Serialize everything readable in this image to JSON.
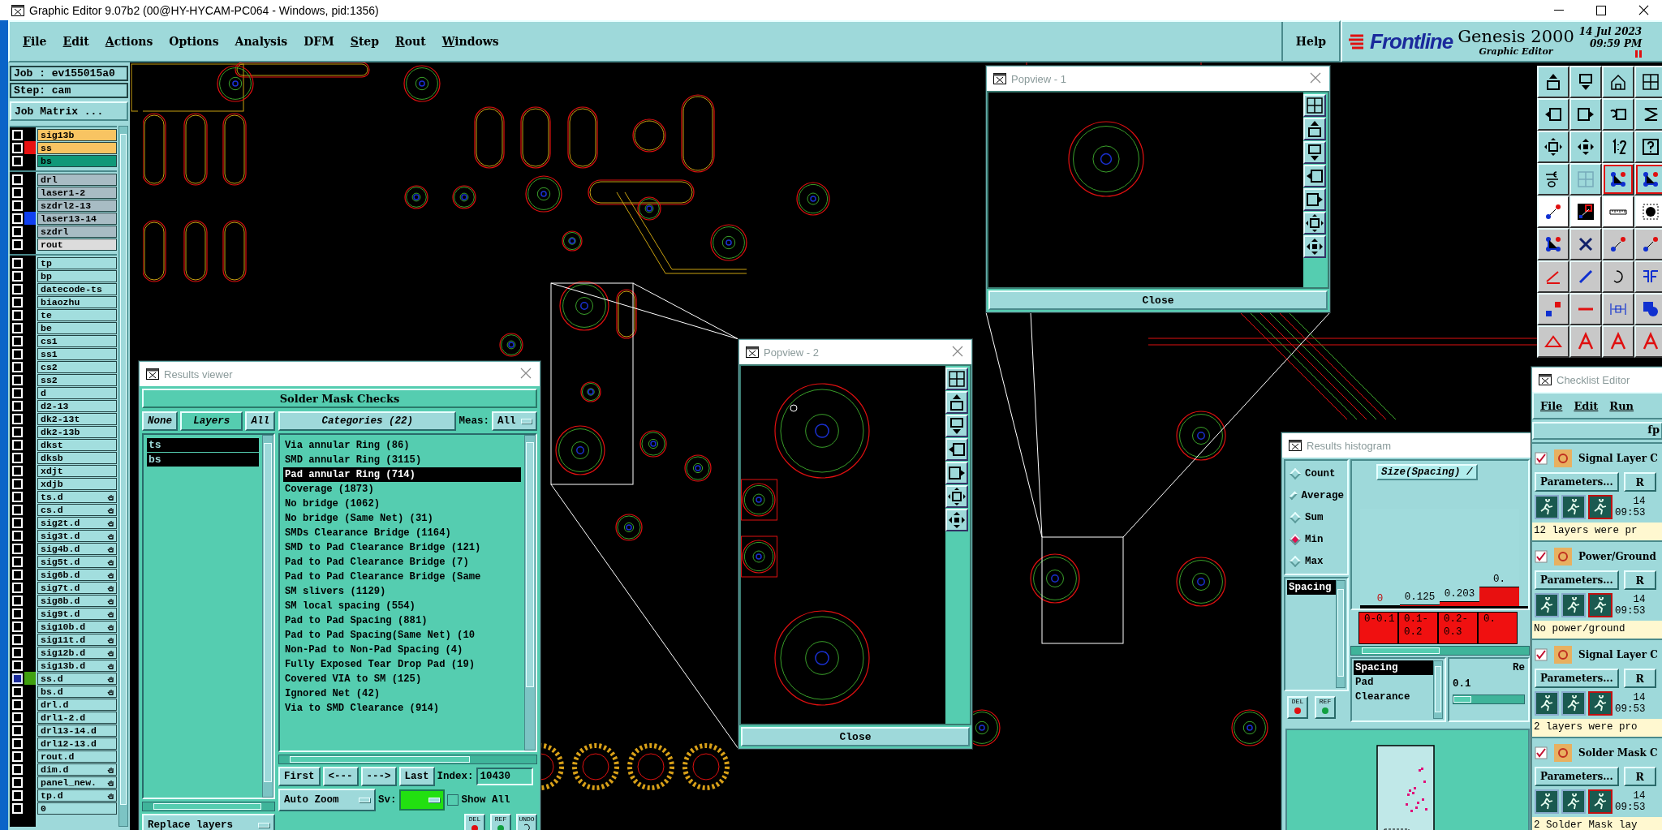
{
  "window": {
    "title": "Graphic Editor 9.07b2 (00@HY-HYCAM-PC064 - Windows, pid:1356)"
  },
  "menu": [
    {
      "label": "File",
      "underlined": true
    },
    {
      "label": "Edit",
      "underlined": true
    },
    {
      "label": "Actions",
      "underlined": true
    },
    {
      "label": "Options",
      "underlined": false
    },
    {
      "label": "Analysis",
      "underlined": false
    },
    {
      "label": "DFM",
      "underlined": false
    },
    {
      "label": "Step",
      "underlined": true
    },
    {
      "label": "Rout",
      "underlined": true
    },
    {
      "label": "Windows",
      "underlined": true
    }
  ],
  "help": "Help",
  "brand": {
    "logo": "Frontline",
    "product": "Genesis 2000",
    "subtitle": "Graphic Editor",
    "date": "14 Jul 2023",
    "time": "09:59 PM"
  },
  "job": {
    "job": "Job : ev155015a0",
    "step": "Step: cam",
    "matrix_button": "Job Matrix ..."
  },
  "layer_groups": [
    {
      "layers": [
        {
          "name": "sig13b",
          "kind": "signal",
          "selected": false,
          "hand": false
        },
        {
          "name": "ss",
          "kind": "signal",
          "color": "#e81010",
          "selected": false,
          "hand": false
        },
        {
          "name": "bs",
          "kind": "mask",
          "selected": false,
          "hand": false
        }
      ]
    },
    {
      "layers": [
        {
          "name": "drl",
          "kind": "drill",
          "selected": false,
          "hand": false
        },
        {
          "name": "laser1-2",
          "kind": "drill",
          "selected": false,
          "hand": false
        },
        {
          "name": "szdrl2-13",
          "kind": "drill",
          "selected": false,
          "hand": false
        },
        {
          "name": "laser13-14",
          "kind": "drill",
          "color": "#1040f0",
          "selected": false,
          "hand": false
        },
        {
          "name": "szdrl",
          "kind": "drill",
          "selected": false,
          "hand": false
        },
        {
          "name": "rout",
          "kind": "rout",
          "selected": false,
          "hand": false
        }
      ]
    },
    {
      "layers": [
        {
          "name": "tp",
          "kind": "misc",
          "selected": false,
          "hand": false
        },
        {
          "name": "bp",
          "kind": "misc",
          "selected": false,
          "hand": false
        },
        {
          "name": "datecode-ts",
          "kind": "misc",
          "selected": false,
          "hand": false
        },
        {
          "name": "biaozhu",
          "kind": "misc",
          "selected": false,
          "hand": false
        },
        {
          "name": "te",
          "kind": "misc",
          "selected": false,
          "hand": false
        },
        {
          "name": "be",
          "kind": "misc",
          "selected": false,
          "hand": false
        },
        {
          "name": "cs1",
          "kind": "misc",
          "selected": false,
          "hand": false
        },
        {
          "name": "ss1",
          "kind": "misc",
          "selected": false,
          "hand": false
        },
        {
          "name": "cs2",
          "kind": "misc",
          "selected": false,
          "hand": false
        },
        {
          "name": "ss2",
          "kind": "misc",
          "selected": false,
          "hand": false
        },
        {
          "name": "d",
          "kind": "misc",
          "selected": false,
          "hand": false
        },
        {
          "name": "d2-13",
          "kind": "misc",
          "selected": false,
          "hand": false
        },
        {
          "name": "dk2-13t",
          "kind": "misc",
          "selected": false,
          "hand": false
        },
        {
          "name": "dk2-13b",
          "kind": "misc",
          "selected": false,
          "hand": false
        },
        {
          "name": "dkst",
          "kind": "misc",
          "selected": false,
          "hand": false
        },
        {
          "name": "dksb",
          "kind": "misc",
          "selected": false,
          "hand": false
        },
        {
          "name": "xdjt",
          "kind": "misc",
          "selected": false,
          "hand": false
        },
        {
          "name": "xdjb",
          "kind": "misc",
          "selected": false,
          "hand": false
        },
        {
          "name": "ts.d",
          "kind": "misc",
          "selected": false,
          "hand": true
        },
        {
          "name": "cs.d",
          "kind": "misc",
          "selected": false,
          "hand": true
        },
        {
          "name": "sig2t.d",
          "kind": "misc",
          "selected": false,
          "hand": true
        },
        {
          "name": "sig3t.d",
          "kind": "misc",
          "selected": false,
          "hand": true
        },
        {
          "name": "sig4b.d",
          "kind": "misc",
          "selected": false,
          "hand": true
        },
        {
          "name": "sig5t.d",
          "kind": "misc",
          "selected": false,
          "hand": true
        },
        {
          "name": "sig6b.d",
          "kind": "misc",
          "selected": false,
          "hand": true
        },
        {
          "name": "sig7t.d",
          "kind": "misc",
          "selected": false,
          "hand": true
        },
        {
          "name": "sig8b.d",
          "kind": "misc",
          "selected": false,
          "hand": true
        },
        {
          "name": "sig9t.d",
          "kind": "misc",
          "selected": false,
          "hand": true
        },
        {
          "name": "sig10b.d",
          "kind": "misc",
          "selected": false,
          "hand": true
        },
        {
          "name": "sig11t.d",
          "kind": "misc",
          "selected": false,
          "hand": true
        },
        {
          "name": "sig12b.d",
          "kind": "misc",
          "selected": false,
          "hand": true
        },
        {
          "name": "sig13b.d",
          "kind": "misc",
          "selected": false,
          "hand": true
        },
        {
          "name": "ss.d",
          "kind": "misc",
          "color": "#40a010",
          "selected": true,
          "hand": true
        },
        {
          "name": "bs.d",
          "kind": "misc",
          "selected": false,
          "hand": true
        },
        {
          "name": "drl.d",
          "kind": "misc",
          "selected": false,
          "hand": false
        },
        {
          "name": "drl1-2.d",
          "kind": "misc",
          "selected": false,
          "hand": false
        },
        {
          "name": "drl13-14.d",
          "kind": "misc",
          "selected": false,
          "hand": false
        },
        {
          "name": "drl12-13.d",
          "kind": "misc",
          "selected": false,
          "hand": false
        },
        {
          "name": "rout.d",
          "kind": "misc",
          "selected": false,
          "hand": false
        },
        {
          "name": "dim.d",
          "kind": "misc",
          "selected": false,
          "hand": true
        },
        {
          "name": "panel_new.",
          "kind": "misc",
          "selected": false,
          "hand": true
        },
        {
          "name": "tp.d",
          "kind": "misc",
          "selected": false,
          "hand": true
        },
        {
          "name": "0",
          "kind": "misc",
          "selected": false,
          "hand": false
        }
      ]
    }
  ],
  "popviews": [
    {
      "title": "Popview - 1",
      "close": "Close"
    },
    {
      "title": "Popview - 2",
      "close": "Close"
    }
  ],
  "results_viewer": {
    "title": "Results viewer",
    "heading": "Solder Mask Checks",
    "none_button": "None",
    "layers_label": "Layers",
    "all_button": "All",
    "layers": [
      {
        "name": "ts",
        "selected": true
      },
      {
        "name": "bs",
        "selected": true
      }
    ],
    "replace": "Replace layers",
    "categories_button": "Categories (22)",
    "meas_label": "Meas:",
    "meas_value": "All",
    "categories": [
      {
        "label": "Via annular Ring (86)",
        "selected": false
      },
      {
        "label": "SMD annular Ring (3115)",
        "selected": false
      },
      {
        "label": "Pad annular Ring (714)",
        "selected": true
      },
      {
        "label": "Coverage (1873)",
        "selected": false
      },
      {
        "label": "No bridge (1062)",
        "selected": false
      },
      {
        "label": "No bridge (Same Net) (31)",
        "selected": false
      },
      {
        "label": "SMDs Clearance Bridge (1164)",
        "selected": false
      },
      {
        "label": "SMD to Pad Clearance Bridge (121)",
        "selected": false
      },
      {
        "label": "Pad to Pad Clearance Bridge (7)",
        "selected": false
      },
      {
        "label": "Pad to Pad Clearance Bridge (Same",
        "selected": false
      },
      {
        "label": "SM slivers (1129)",
        "selected": false
      },
      {
        "label": "SM local spacing (554)",
        "selected": false
      },
      {
        "label": "Pad to Pad Spacing (881)",
        "selected": false
      },
      {
        "label": "Pad to Pad Spacing(Same Net) (10",
        "selected": false
      },
      {
        "label": "Non-Pad to Non-Pad Spacing (4)",
        "selected": false
      },
      {
        "label": "Fully Exposed Tear Drop Pad (19)",
        "selected": false
      },
      {
        "label": "Covered VIA to SM (125)",
        "selected": false
      },
      {
        "label": "Ignored Net (42)",
        "selected": false
      },
      {
        "label": "Via to SMD Clearance (914)",
        "selected": false
      }
    ],
    "nav": [
      "First",
      "<---",
      "--->",
      "Last"
    ],
    "index_label": "Index:",
    "index_value": "10430",
    "zoom": "Auto Zoom",
    "sv_label": "Sv:",
    "show_all": {
      "label": "Show All",
      "checked": false
    },
    "actions": [
      "DEL",
      "REF",
      "UNDO"
    ]
  },
  "histogram": {
    "title": "Results histogram",
    "modes": [
      {
        "label": "Count",
        "selected": false
      },
      {
        "label": "Average",
        "selected": false
      },
      {
        "label": "Sum",
        "selected": false
      },
      {
        "label": "Min",
        "selected": true
      },
      {
        "label": "Max",
        "selected": false
      }
    ],
    "fields": [
      {
        "label": "Spacing",
        "selected": true
      }
    ],
    "actions": [
      "DEL",
      "REF"
    ],
    "chart_title": "Size(Spacing) /",
    "bins": [
      {
        "value": "0",
        "range": "0-0.1",
        "level": 0
      },
      {
        "value": "0.125",
        "range": "0.1-0.2",
        "level": 0.02
      },
      {
        "value": "0.203",
        "range": "0.2-0.3",
        "level": 0.05
      },
      {
        "value": "0.",
        "range": "0.",
        "level": 0.2
      }
    ],
    "attributes": [
      {
        "label": "Spacing",
        "selected": true
      },
      {
        "label": "Pad",
        "selected": false
      },
      {
        "label": "Clearance",
        "selected": false
      }
    ],
    "range_label": "Re",
    "range_value": "0.1",
    "range_slider": {
      "level": 0.25
    }
  },
  "checklist": {
    "title": "Checklist Editor",
    "menu": [
      "File",
      "Edit",
      "Run"
    ],
    "field": "fp",
    "checks": [
      {
        "name": "Signal Layer C",
        "checked": true,
        "params": "Parameters...",
        "run": "R",
        "date": "14",
        "time": "09:53",
        "message": "12 layers were pr"
      },
      {
        "name": "Power/Ground",
        "checked": true,
        "params": "Parameters...",
        "run": "R",
        "date": "14",
        "time": "09:53",
        "message": "No power/ground"
      },
      {
        "name": "Signal Layer C",
        "checked": true,
        "params": "Parameters...",
        "run": "R",
        "date": "14",
        "time": "09:53",
        "message": "2 layers were pro"
      },
      {
        "name": "Solder Mask C",
        "checked": true,
        "params": "Parameters...",
        "run": "R",
        "date": "14",
        "time": "09:53",
        "message": "2 Solder Mask lay"
      }
    ]
  }
}
